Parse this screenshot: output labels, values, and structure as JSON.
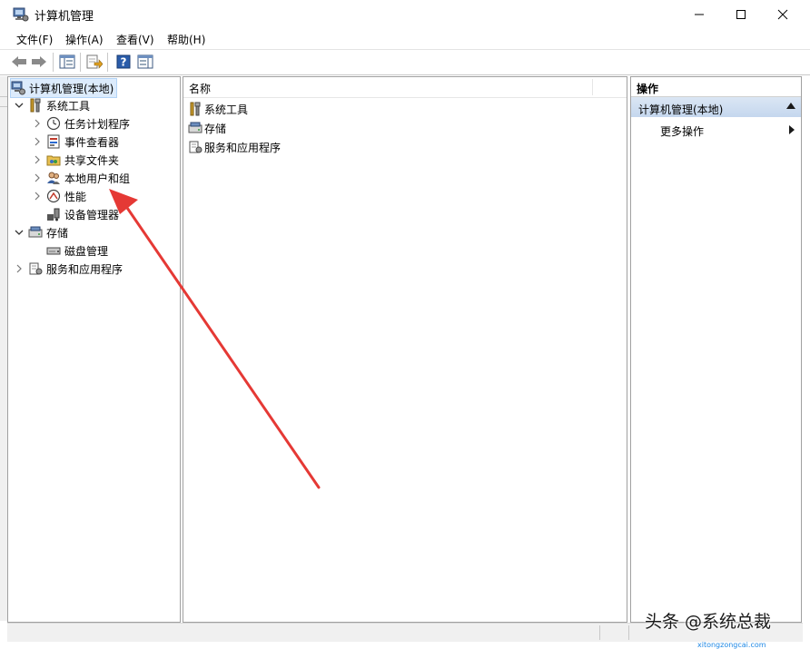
{
  "window": {
    "title": "计算机管理"
  },
  "menu": {
    "items": [
      "文件(F)",
      "操作(A)",
      "查看(V)",
      "帮助(H)"
    ]
  },
  "tree": {
    "root": "计算机管理(本地)",
    "system_tools": "系统工具",
    "task_scheduler": "任务计划程序",
    "event_viewer": "事件查看器",
    "shared_folders": "共享文件夹",
    "local_users_groups": "本地用户和组",
    "performance": "性能",
    "device_manager": "设备管理器",
    "storage": "存储",
    "disk_management": "磁盘管理",
    "services_apps": "服务和应用程序"
  },
  "list": {
    "column_name": "名称",
    "rows": [
      "系统工具",
      "存储",
      "服务和应用程序"
    ]
  },
  "actions": {
    "header": "操作",
    "section": "计算机管理(本地)",
    "more": "更多操作"
  },
  "watermark": {
    "text": "头条 @系统总裁",
    "url": "xitongzongcai.com"
  },
  "colors": {
    "annotation_arrow": "#e53935",
    "selection_bg": "#dcebfc",
    "actions_section_bg": "#c5d7ee"
  }
}
